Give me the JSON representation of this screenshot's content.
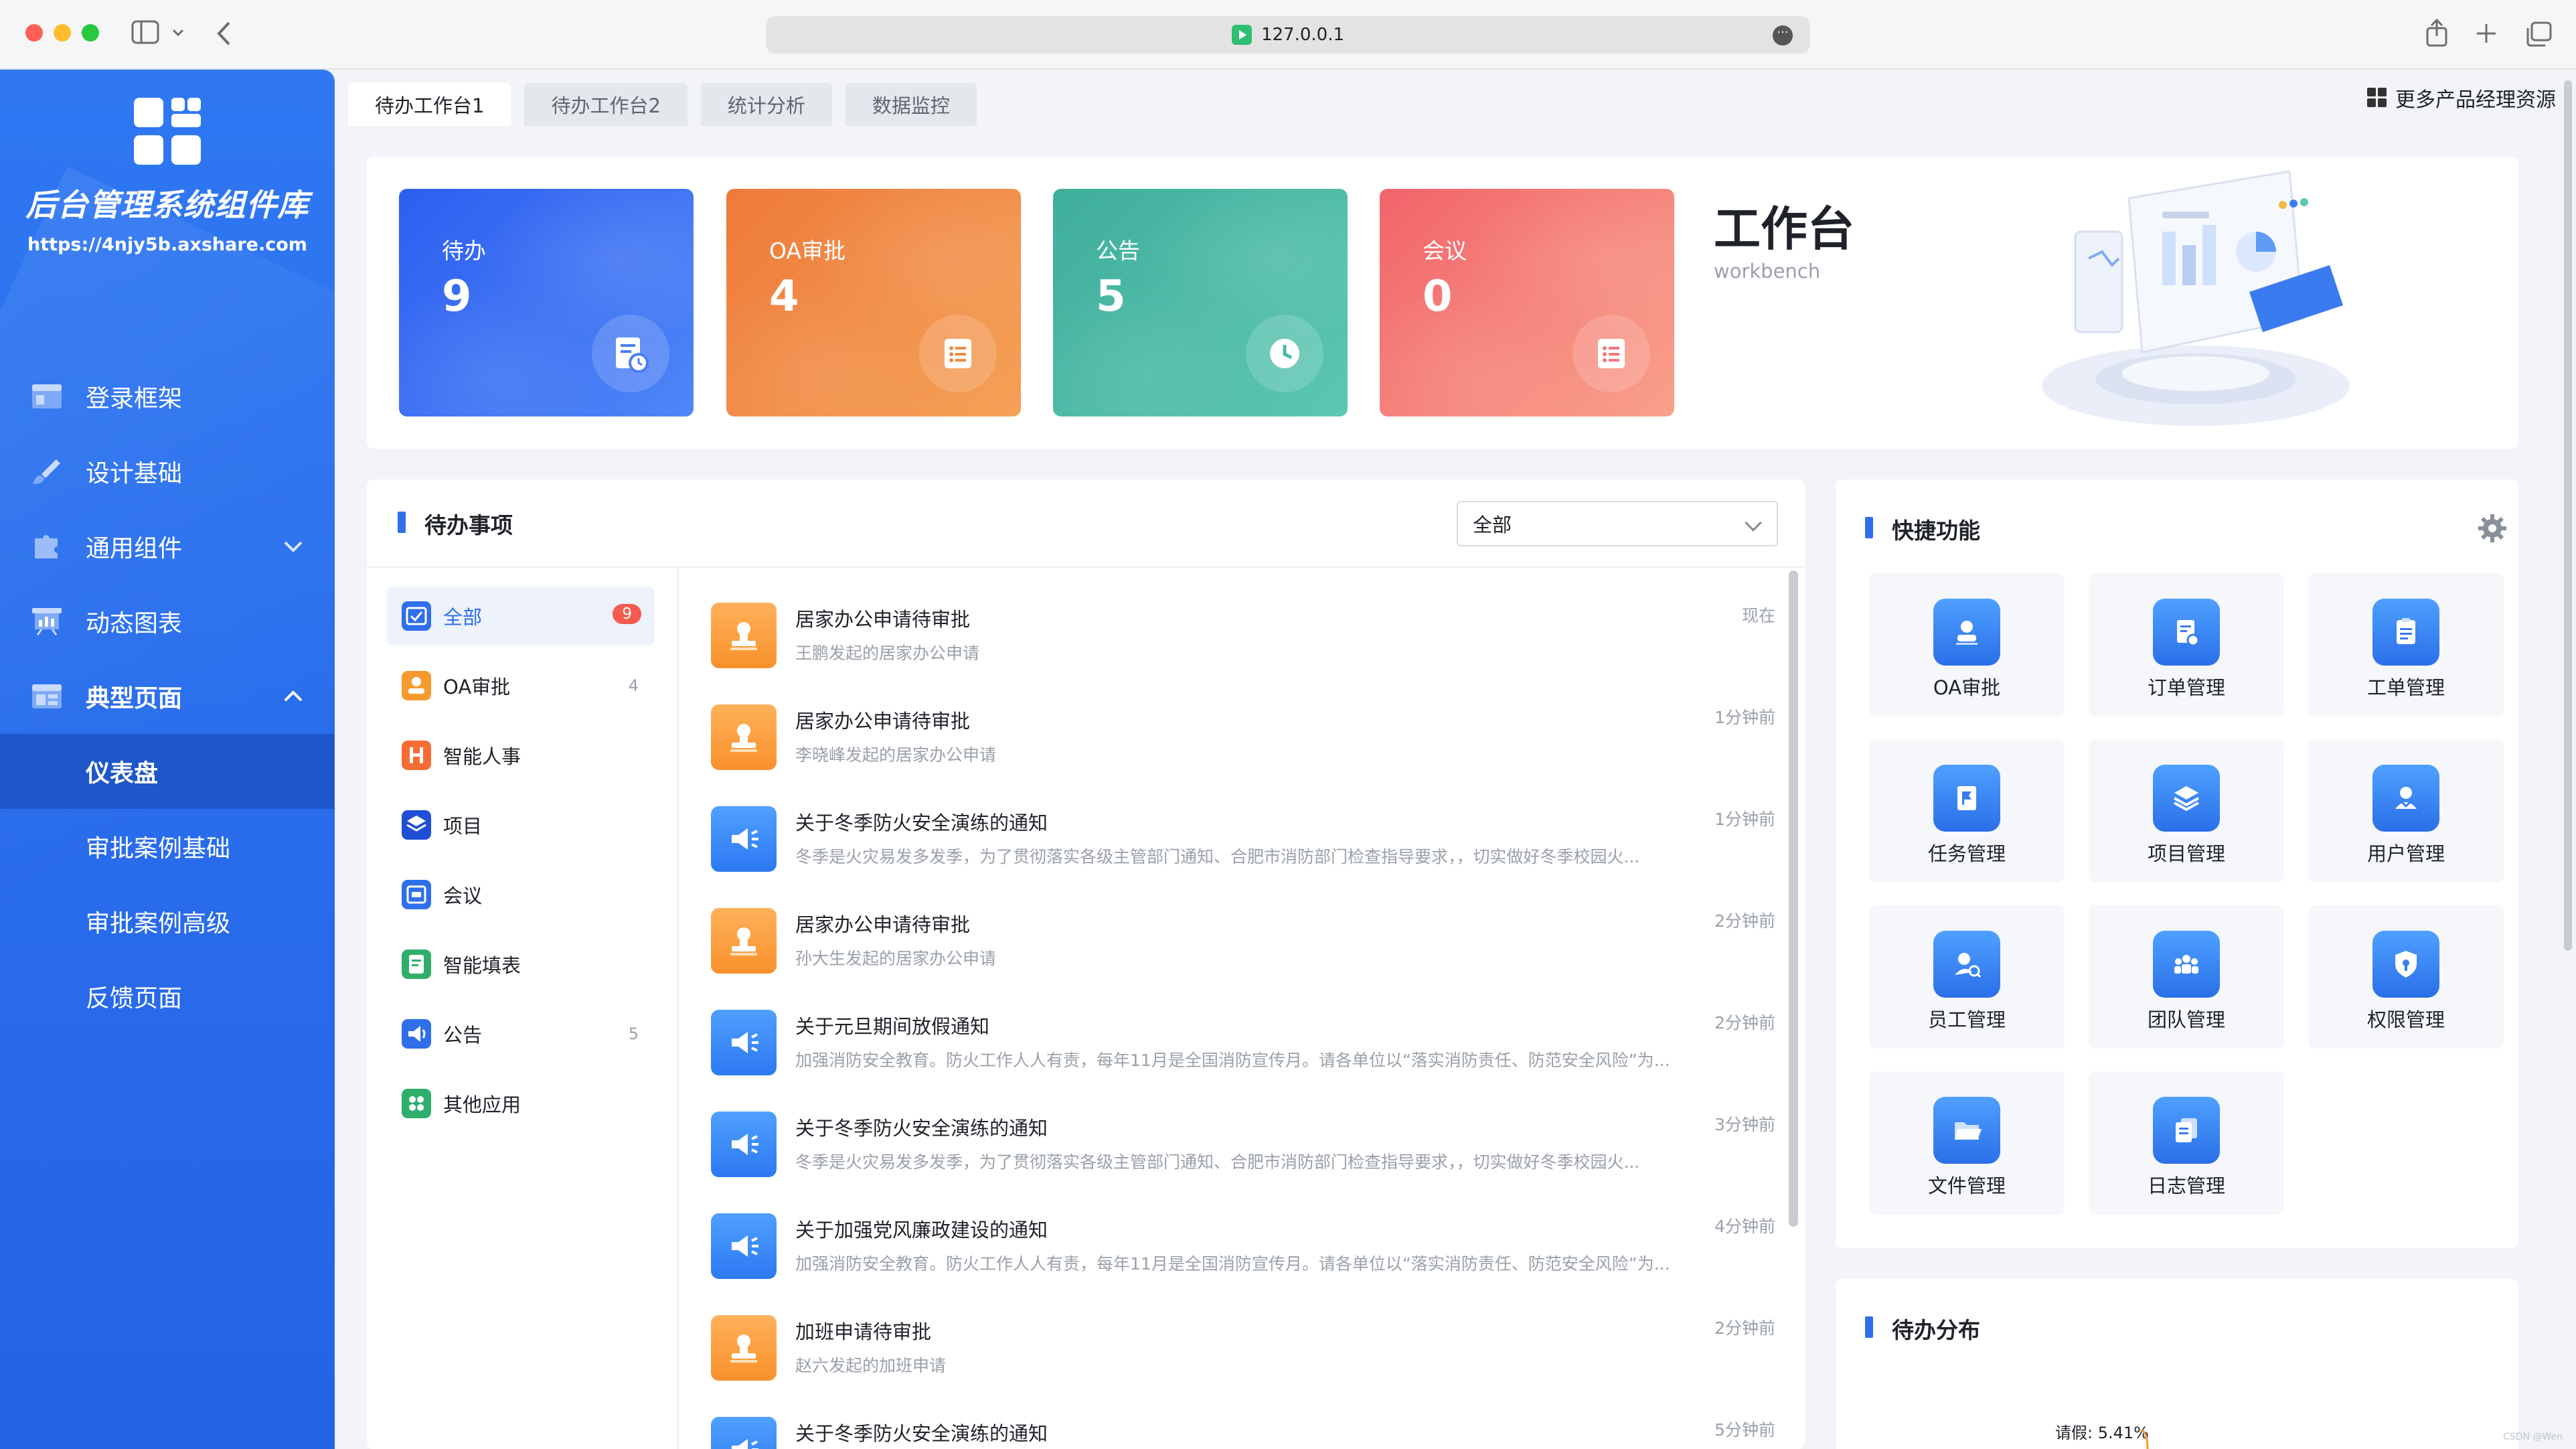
{
  "browser": {
    "url": "127.0.0.1"
  },
  "sidebar": {
    "title": "后台管理系统组件库",
    "url": "https://4njy5b.axshare.com",
    "items": [
      {
        "label": "登录框架",
        "icon": "window-icon"
      },
      {
        "label": "设计基础",
        "icon": "brush-icon"
      },
      {
        "label": "通用组件",
        "icon": "puzzle-icon",
        "expanded": false
      },
      {
        "label": "动态图表",
        "icon": "chart-board-icon"
      },
      {
        "label": "典型页面",
        "icon": "layout-icon",
        "expanded": true
      }
    ],
    "sub_items": [
      {
        "label": "仪表盘",
        "active": true
      },
      {
        "label": "审批案例基础",
        "active": false
      },
      {
        "label": "审批案例高级",
        "active": false
      },
      {
        "label": "反馈页面",
        "active": false
      }
    ]
  },
  "tabs": [
    {
      "label": "待办工作台1",
      "active": true
    },
    {
      "label": "待办工作台2",
      "active": false
    },
    {
      "label": "统计分析",
      "active": false
    },
    {
      "label": "数据监控",
      "active": false
    }
  ],
  "header_link": "更多产品经理资源",
  "stats": [
    {
      "label": "待办",
      "value": "9",
      "color_from": "#2d5ff0",
      "color_to": "#4f86f7",
      "icon": "document-clock-icon"
    },
    {
      "label": "OA审批",
      "value": "4",
      "color_from": "#ee7a3a",
      "color_to": "#f5a157",
      "icon": "list-icon"
    },
    {
      "label": "公告",
      "value": "5",
      "color_from": "#3fae9b",
      "color_to": "#5cc7b3",
      "icon": "clock-icon"
    },
    {
      "label": "会议",
      "value": "0",
      "color_from": "#f2646a",
      "color_to": "#f9a18b",
      "icon": "list-icon"
    }
  ],
  "workbench": {
    "title": "工作台",
    "subtitle": "workbench"
  },
  "todo": {
    "title": "待办事项",
    "filter": "全部",
    "categories": [
      {
        "label": "全部",
        "count": "9",
        "color": "#2f6fea",
        "active": true
      },
      {
        "label": "OA审批",
        "count": "4",
        "color": "#f79a2e",
        "active": false
      },
      {
        "label": "智能人事",
        "count": "",
        "color": "#f56d34",
        "active": false
      },
      {
        "label": "项目",
        "count": "",
        "color": "#1f4fd6",
        "active": false
      },
      {
        "label": "会议",
        "count": "",
        "color": "#2f6fea",
        "active": false
      },
      {
        "label": "智能填表",
        "count": "",
        "color": "#2fae6a",
        "active": false
      },
      {
        "label": "公告",
        "count": "5",
        "color": "#2f6fea",
        "active": false
      },
      {
        "label": "其他应用",
        "count": "",
        "color": "#2fae6a",
        "active": false
      }
    ],
    "items": [
      {
        "kind": "approval",
        "title": "居家办公申请待审批",
        "desc": "王鹏发起的居家办公申请",
        "time": "现在"
      },
      {
        "kind": "approval",
        "title": "居家办公申请待审批",
        "desc": "李晓峰发起的居家办公申请",
        "time": "1分钟前"
      },
      {
        "kind": "notice",
        "title": "关于冬季防火安全演练的通知",
        "desc": "冬季是火灾易发多发季，为了贯彻落实各级主管部门通知、合肥市消防部门检查指导要求，，切实做好冬季校园火...",
        "time": "1分钟前"
      },
      {
        "kind": "approval",
        "title": "居家办公申请待审批",
        "desc": "孙大生发起的居家办公申请",
        "time": "2分钟前"
      },
      {
        "kind": "notice",
        "title": "关于元旦期间放假通知",
        "desc": "加强消防安全教育。防火工作人人有责，每年11月是全国消防宣传月。请各单位以“落实消防责任、防范安全风险”为...",
        "time": "2分钟前"
      },
      {
        "kind": "notice",
        "title": "关于冬季防火安全演练的通知",
        "desc": "冬季是火灾易发多发季，为了贯彻落实各级主管部门通知、合肥市消防部门检查指导要求，，切实做好冬季校园火...",
        "time": "3分钟前"
      },
      {
        "kind": "notice",
        "title": "关于加强党风廉政建设的通知",
        "desc": "加强消防安全教育。防火工作人人有责，每年11月是全国消防宣传月。请各单位以“落实消防责任、防范安全风险”为...",
        "time": "4分钟前"
      },
      {
        "kind": "approval",
        "title": "加班申请待审批",
        "desc": "赵六发起的加班申请",
        "time": "2分钟前"
      },
      {
        "kind": "notice",
        "title": "关于冬季防火安全演练的通知",
        "desc": "",
        "time": "5分钟前"
      }
    ]
  },
  "quick": {
    "title": "快捷功能",
    "items": [
      {
        "label": "OA审批",
        "icon": "person-icon"
      },
      {
        "label": "订单管理",
        "icon": "order-icon"
      },
      {
        "label": "工单管理",
        "icon": "clipboard-icon"
      },
      {
        "label": "任务管理",
        "icon": "flag-icon"
      },
      {
        "label": "项目管理",
        "icon": "layers-icon"
      },
      {
        "label": "用户管理",
        "icon": "users-icon"
      },
      {
        "label": "员工管理",
        "icon": "staff-icon"
      },
      {
        "label": "团队管理",
        "icon": "team-icon"
      },
      {
        "label": "权限管理",
        "icon": "shield-icon"
      },
      {
        "label": "文件管理",
        "icon": "folder-icon"
      },
      {
        "label": "日志管理",
        "icon": "copy-icon"
      }
    ]
  },
  "distribution": {
    "title": "待办分布",
    "pie_label": "请假: 5.41%"
  },
  "watermark": "CSDN @Wen"
}
